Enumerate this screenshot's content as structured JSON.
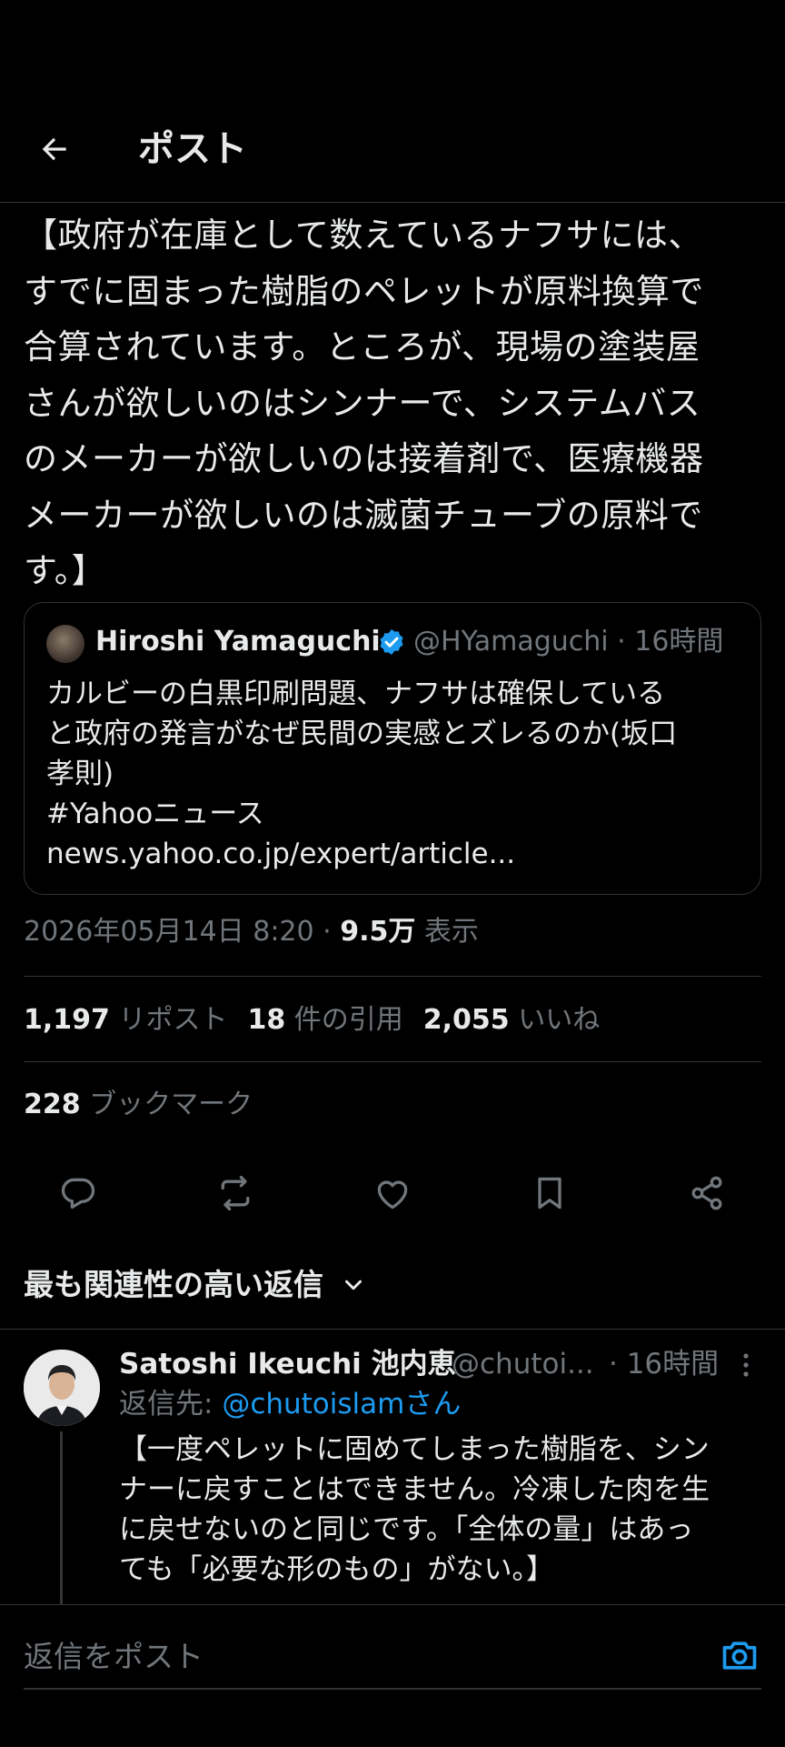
{
  "header": {
    "title": "ポスト",
    "back_icon": "arrow-left-icon"
  },
  "post": {
    "body_lines": [
      "【政府が在庫として数えているナフサには、",
      "すでに固まった樹脂のペレットが原料換算で",
      "合算されています。ところが、現場の塗装屋",
      "さんが欲しいのはシンナーで、システムバス",
      "のメーカーが欲しいのは接着剤で、医療機器",
      "メーカーが欲しいのは滅菌チューブの原料で",
      "す。】"
    ],
    "quote": {
      "name": "Hiroshi Yamaguchi",
      "handle_time": "@HYamaguchi · 16時間",
      "lines": [
        "カルビーの白黒印刷問題、ナフサは確保している",
        "と政府の発言がなぜ民間の実感とズレるのか(坂口",
        "孝則)",
        "#Yahooニュース",
        "news.yahoo.co.jp/expert/article..."
      ]
    },
    "timestamp": "2026年05月14日 8:20",
    "separator": " · ",
    "views_count": "9.5万",
    "views_label": " 表示",
    "stats": {
      "reposts_count": "1,197",
      "reposts_label": " リポスト",
      "quotes_count": "18",
      "quotes_label": " 件の引用",
      "likes_count": "2,055",
      "likes_label": " いいね",
      "bookmarks_count": "228",
      "bookmarks_label": " ブックマーク"
    }
  },
  "actions": [
    "reply-icon",
    "repost-icon",
    "like-icon",
    "bookmark-icon",
    "share-icon"
  ],
  "replies": {
    "sort_label": "最も関連性の高い返信",
    "items": [
      {
        "name": "Satoshi Ikeuchi 池内恵",
        "handle": "@chutoi...",
        "time": "· 16時間",
        "reply_to_label": "返信先: ",
        "reply_to_handle": "@chutoislamさん",
        "lines": [
          "【一度ペレットに固めてしまった樹脂を、シン",
          "ナーに戻すことはできません。冷凍した肉を生",
          "に戻せないのと同じです。「全体の量」はあっ",
          "ても「必要な形のもの」がない。】"
        ]
      }
    ]
  },
  "composer": {
    "placeholder": "返信をポスト",
    "camera_icon": "camera-icon"
  },
  "colors": {
    "background": "#000000",
    "text": "#e7e9ea",
    "muted": "#71767b",
    "accent": "#1d9bf0",
    "border": "#2f3336"
  }
}
